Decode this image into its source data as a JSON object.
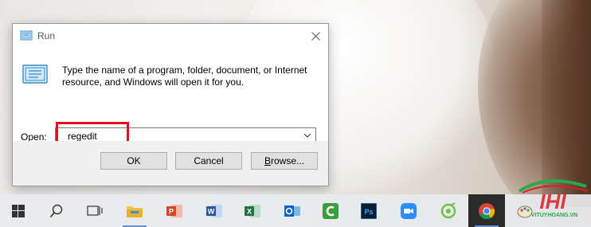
{
  "dialog": {
    "title": "Run",
    "description": "Type the name of a program, folder, document, or Internet resource, and Windows will open it for you.",
    "open_label_prefix": "",
    "open_label_accel": "O",
    "open_label_rest": "pen:",
    "open_value": "regedit",
    "buttons": {
      "ok": "OK",
      "cancel": "Cancel",
      "browse_accel": "B",
      "browse_rest": "rowse..."
    }
  },
  "taskbar": {
    "items": [
      {
        "name": "start-icon"
      },
      {
        "name": "search-icon"
      },
      {
        "name": "task-view-icon"
      },
      {
        "name": "file-explorer-icon"
      },
      {
        "name": "powerpoint-icon"
      },
      {
        "name": "word-icon"
      },
      {
        "name": "excel-icon"
      },
      {
        "name": "outlook-icon"
      },
      {
        "name": "camtasia-icon"
      },
      {
        "name": "photoshop-icon"
      },
      {
        "name": "zoom-icon"
      },
      {
        "name": "app-icon"
      },
      {
        "name": "chrome-icon"
      },
      {
        "name": "paint-icon"
      }
    ]
  },
  "colors": {
    "highlight": "#e0101e",
    "taskbar_active": "#2b2b2b"
  },
  "watermark": {
    "text": "VITUYHOANG.VN"
  }
}
